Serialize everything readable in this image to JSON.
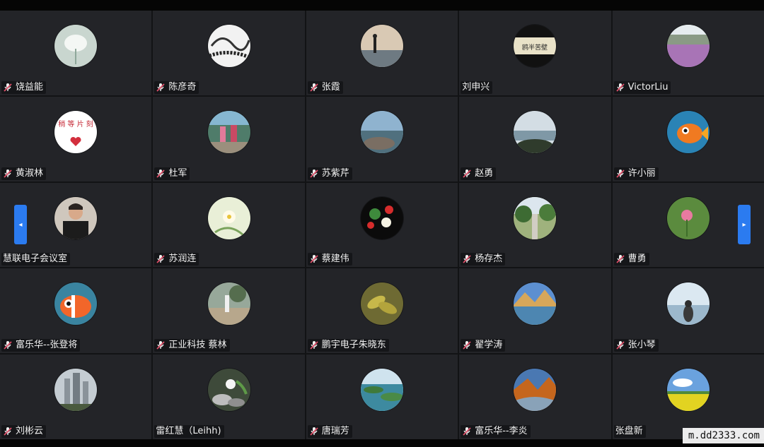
{
  "participants": [
    {
      "name": "饶益能",
      "muted": true,
      "avatar": "white-lotus"
    },
    {
      "name": "陈彦奇",
      "muted": true,
      "avatar": "ink-sketch"
    },
    {
      "name": "张霞",
      "muted": true,
      "avatar": "seaside-person"
    },
    {
      "name": "刘申兴",
      "muted": false,
      "avatar": "calligraphy-plaque",
      "avatar_text": "鸥半苦壁"
    },
    {
      "name": "VictorLiu",
      "muted": true,
      "avatar": "lavender-field"
    },
    {
      "name": "黄淑林",
      "muted": true,
      "avatar": "please-wait-card",
      "avatar_text": "稍 等 片 刻"
    },
    {
      "name": "杜军",
      "muted": true,
      "avatar": "kids-photo"
    },
    {
      "name": "苏紫芹",
      "muted": true,
      "avatar": "rocky-coast"
    },
    {
      "name": "赵勇",
      "muted": true,
      "avatar": "lake-hills"
    },
    {
      "name": "许小丽",
      "muted": true,
      "avatar": "cartoon-fish"
    },
    {
      "name": "慧联电子会议室",
      "muted": false,
      "avatar": "man-portrait"
    },
    {
      "name": "苏润连",
      "muted": true,
      "avatar": "white-flower"
    },
    {
      "name": "蔡建伟",
      "muted": true,
      "avatar": "flower-tile"
    },
    {
      "name": "杨存杰",
      "muted": true,
      "avatar": "tree-path"
    },
    {
      "name": "曹勇",
      "muted": true,
      "avatar": "pink-lotus"
    },
    {
      "name": "富乐华--张登将",
      "muted": true,
      "avatar": "clownfish"
    },
    {
      "name": "正业科技 蔡林",
      "muted": true,
      "avatar": "garden-walk"
    },
    {
      "name": "鹏宇电子朱晓东",
      "muted": true,
      "avatar": "olive-branch"
    },
    {
      "name": "翟学涛",
      "muted": true,
      "avatar": "mountain-lake"
    },
    {
      "name": "张小琴",
      "muted": true,
      "avatar": "woman-sea"
    },
    {
      "name": "刘彬云",
      "muted": true,
      "avatar": "city-towers"
    },
    {
      "name": "雷红慧（Leihh)",
      "muted": false,
      "avatar": "lotus-stones"
    },
    {
      "name": "唐瑞芳",
      "muted": true,
      "avatar": "green-islands"
    },
    {
      "name": "富乐华--李炎",
      "muted": true,
      "avatar": "autumn-valley"
    },
    {
      "name": "张盘新",
      "muted": false,
      "avatar": "canola-field"
    }
  ],
  "navigation": {
    "prev_icon": "chevron-left-icon",
    "next_icon": "chevron-right-icon",
    "prev_glyph": "◂",
    "next_glyph": "▸"
  },
  "watermark": "m.dd2333.com",
  "colors": {
    "tile_bg": "#232428",
    "accent": "#2b7bf0",
    "muted_icon": "#e0506a"
  }
}
